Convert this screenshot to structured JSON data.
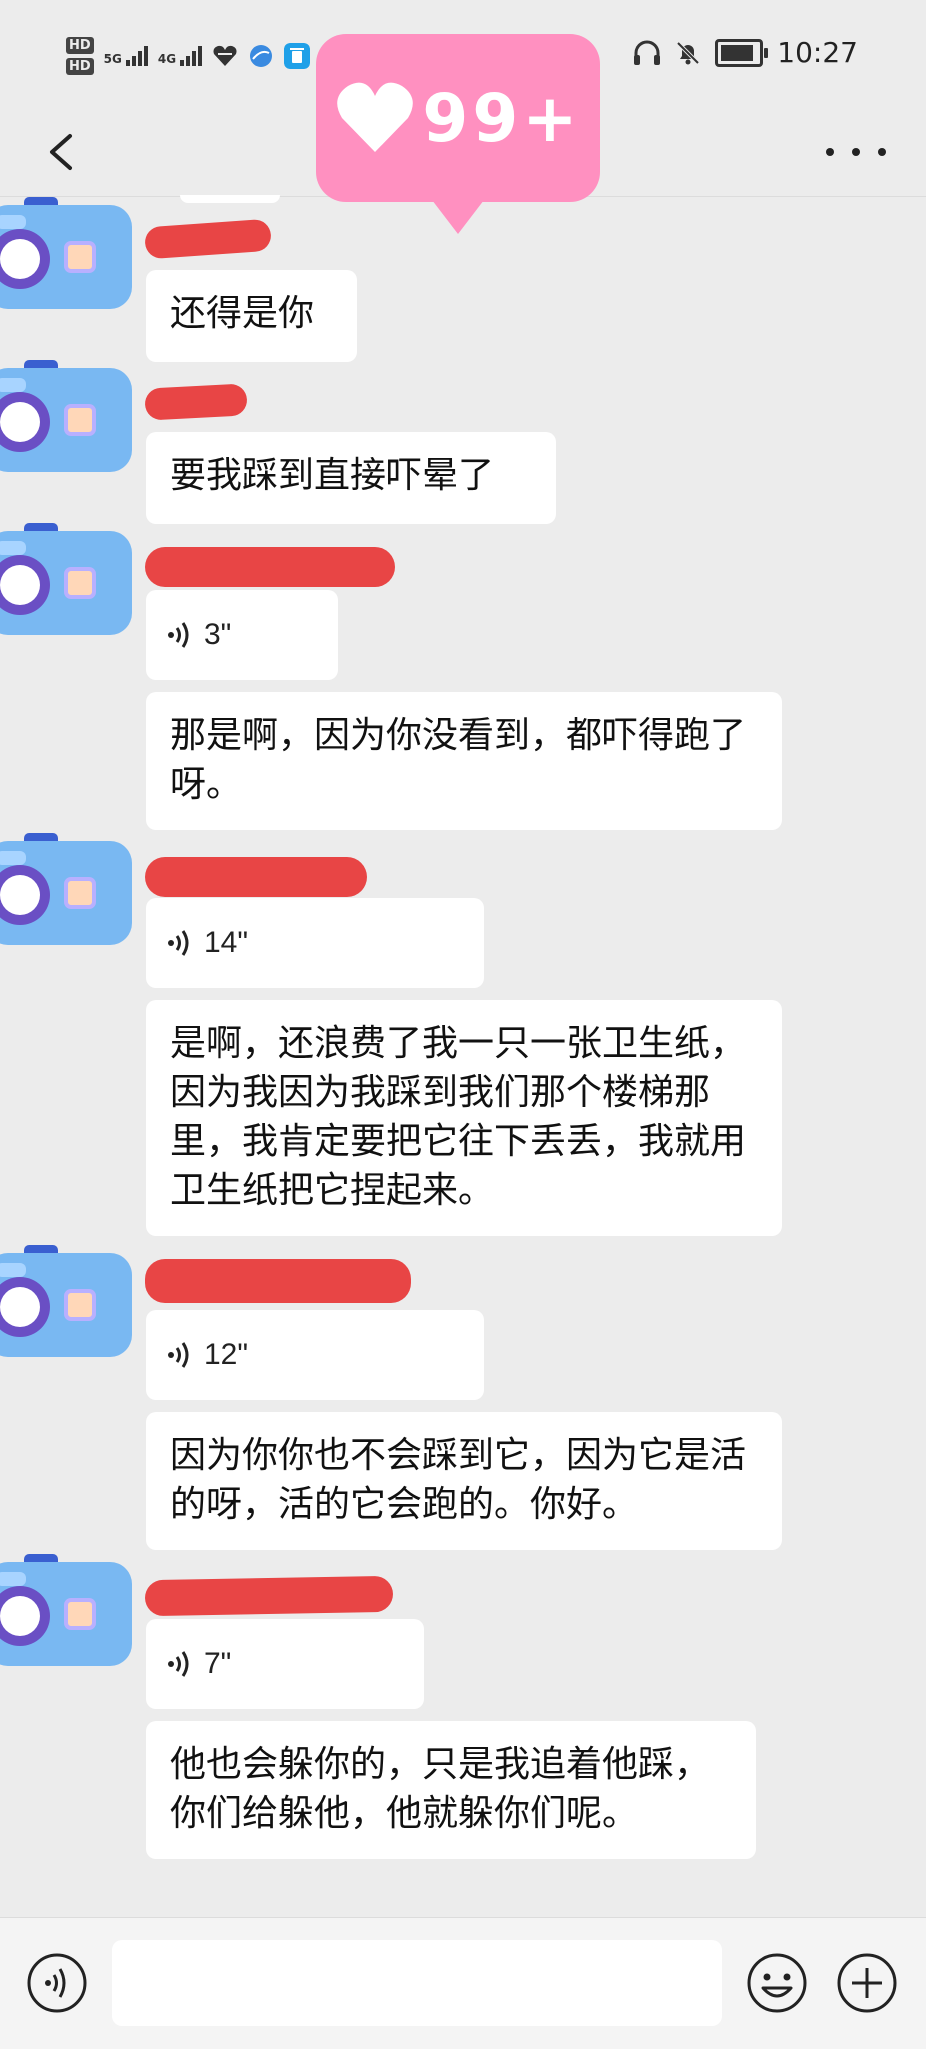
{
  "status_bar": {
    "hd1": "HD",
    "hd2": "HD",
    "network1": "5G",
    "network2": "4G",
    "time": "10:27"
  },
  "badge": {
    "text": "99+"
  },
  "input_bar": {
    "placeholder": ""
  },
  "messages": [
    {
      "type": "text",
      "text": "还得是你"
    },
    {
      "type": "text",
      "text": "要我踩到直接吓晕了"
    },
    {
      "type": "voice",
      "duration": "3\""
    },
    {
      "type": "text",
      "text": "那是啊，因为你没看到，都吓得跑了呀。"
    },
    {
      "type": "voice",
      "duration": "14\""
    },
    {
      "type": "text",
      "text": "是啊，还浪费了我一只一张卫生纸，因为我因为我踩到我们那个楼梯那里，我肯定要把它往下丢丢，我就用卫生纸把它捏起来。"
    },
    {
      "type": "voice",
      "duration": "12\""
    },
    {
      "type": "text",
      "text": "因为你你也不会踩到它，因为它是活的呀，活的它会跑的。你好。"
    },
    {
      "type": "voice",
      "duration": "7\""
    },
    {
      "type": "text",
      "text": "他也会躲你的，只是我追着他踩，你们给躲他，他就躲你们呢。"
    }
  ],
  "icons": {
    "back": "back-arrow-icon",
    "more": "more-dots-icon",
    "voice": "voice-wave-icon",
    "emoji": "smiley-icon",
    "plus": "plus-circle-icon",
    "headphones": "headphones-icon",
    "mute": "bell-muted-icon",
    "battery": "battery-icon"
  },
  "colors": {
    "badge": "#ff90c0",
    "redaction": "#e84545",
    "background": "#ececec"
  }
}
